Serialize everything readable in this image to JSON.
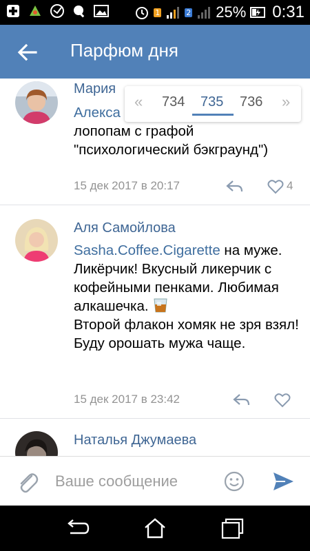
{
  "status_bar": {
    "battery": "25%",
    "time": "0:31",
    "sim1": "1",
    "sim2": "2",
    "colors": {
      "background": "#000000"
    }
  },
  "header": {
    "title": "Парфюм дня",
    "color": "#5181b8"
  },
  "pager": {
    "prev_label": "«",
    "pages": [
      "734",
      "735",
      "736"
    ],
    "current_page": "735",
    "next_label": "»"
  },
  "comments": [
    {
      "author": "Мария",
      "text_mention": "Алекса",
      "text": "лопопам с графой \"психологический бэкграунд\")",
      "date": "15 дек 2017 в 20:17",
      "likes": "4"
    },
    {
      "author": "Аля Самойлова",
      "text_mention": "Sasha.Coffee.Cigarette",
      "text_part1": " на муже. Ликёрчик! Вкусный ликерчик с кофейными пенками. Любимая алкашечка. ",
      "text_emoji": "tumbler-glass-emoji",
      "text_part2": "Второй флакон хомяк не зря взял! Буду орошать мужа чаще.",
      "date": "15 дек 2017 в 23:42",
      "likes": ""
    },
    {
      "author": "Наталья Джумаева"
    }
  ],
  "composer": {
    "placeholder": "Ваше сообщение",
    "icons": [
      "paperclip-icon",
      "smiley-icon",
      "send-icon"
    ]
  },
  "nav": {
    "icons": [
      "back-icon",
      "home-icon",
      "recents-icon"
    ]
  }
}
